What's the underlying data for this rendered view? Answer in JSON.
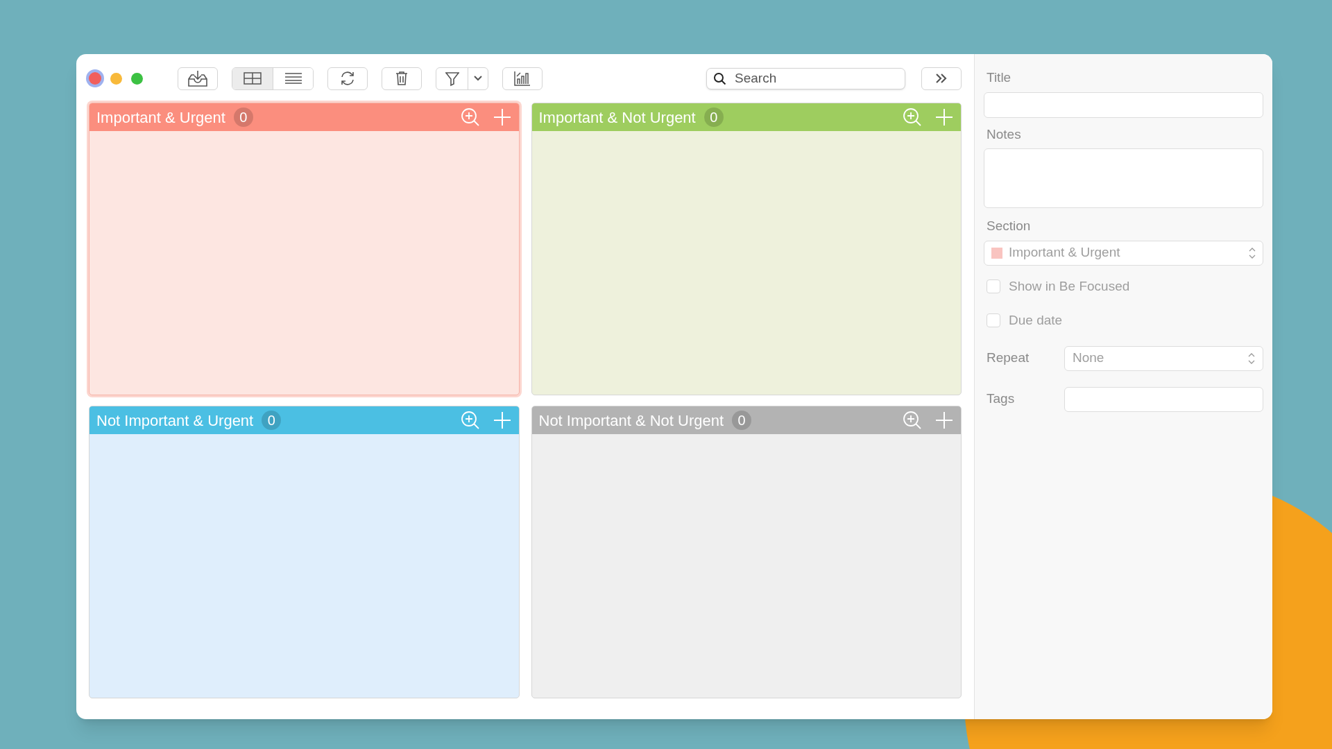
{
  "toolbar": {
    "view_modes": [
      {
        "kind": "grid",
        "selected": true
      },
      {
        "kind": "list",
        "selected": false
      }
    ],
    "search": {
      "placeholder": "Search"
    }
  },
  "quadrants": [
    {
      "title": "Important & Urgent",
      "count": "0",
      "color": "#fb8e7e",
      "selected": true
    },
    {
      "title": "Important & Not Urgent",
      "count": "0",
      "color": "#9ecd5f",
      "selected": false
    },
    {
      "title": "Not Important & Urgent",
      "count": "0",
      "color": "#4bbfe3",
      "selected": false
    },
    {
      "title": "Not Important & Not Urgent",
      "count": "0",
      "color": "#b3b3b3",
      "selected": false
    }
  ],
  "inspector": {
    "title_label": "Title",
    "notes_label": "Notes",
    "section_label": "Section",
    "section": {
      "value": "Important & Urgent",
      "color": "#f9c4c0"
    },
    "checkboxes": [
      {
        "label": "Show in Be Focused",
        "checked": false
      },
      {
        "label": "Due date",
        "checked": false
      }
    ],
    "repeat_label": "Repeat",
    "repeat_value": "None",
    "tags_label": "Tags"
  }
}
